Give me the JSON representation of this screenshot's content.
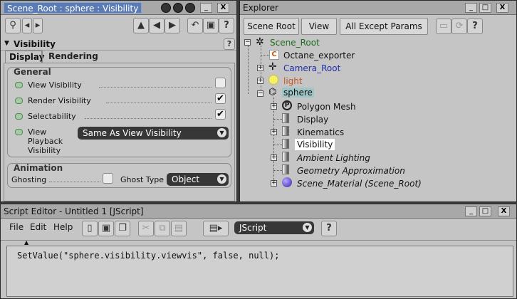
{
  "property_panel": {
    "title": "Scene_Root : sphere : Visibility",
    "section_title": "Visibility",
    "tabs": [
      {
        "label": "Display",
        "active": true
      },
      {
        "label": "Rendering",
        "active": false
      }
    ],
    "general": {
      "label": "General",
      "rows": [
        {
          "label": "View Visibility",
          "checked": false
        },
        {
          "label": "Render Visibility",
          "checked": true
        },
        {
          "label": "Selectability",
          "checked": true
        }
      ],
      "playback_label_lines": [
        "View",
        "Playback",
        "Visibility"
      ],
      "playback_value": "Same As View Visibility"
    },
    "animation": {
      "label": "Animation",
      "ghosting_label": "Ghosting",
      "ghost_type_label": "Ghost Type",
      "ghost_type_value": "Object"
    },
    "help_glyph": "?"
  },
  "explorer": {
    "title": "Explorer",
    "toolbar": {
      "scope": "Scene Root",
      "view": "View",
      "filter": "All Except Params",
      "help": "?"
    },
    "tree": [
      {
        "label": "Scene_Root",
        "color": "#1d6b1d"
      },
      {
        "label": "Octane_exporter",
        "color": "#111111"
      },
      {
        "label": "Camera_Root",
        "color": "#1f2fa8"
      },
      {
        "label": "light",
        "color": "#c9541e"
      },
      {
        "label": "sphere",
        "color": "#111111"
      },
      {
        "label": "Polygon Mesh",
        "color": "#111111"
      },
      {
        "label": "Display",
        "color": "#111111"
      },
      {
        "label": "Kinematics",
        "color": "#111111"
      },
      {
        "label": "Visibility",
        "color": "#111111"
      },
      {
        "label": "Ambient Lighting",
        "color": "#111111"
      },
      {
        "label": "Geometry Approximation",
        "color": "#111111"
      },
      {
        "label": "Scene_Material (Scene_Root)",
        "color": "#111111"
      }
    ]
  },
  "script_editor": {
    "title": "Script Editor - Untitled 1  [JScript]",
    "menu": [
      "File",
      "Edit",
      "Help"
    ],
    "language": "JScript",
    "help": "?",
    "code": "SetValue(\"sphere.visibility.viewvis\", false, null);"
  },
  "window_controls": {
    "minimize": "_",
    "maximize": "□",
    "close": "X"
  }
}
